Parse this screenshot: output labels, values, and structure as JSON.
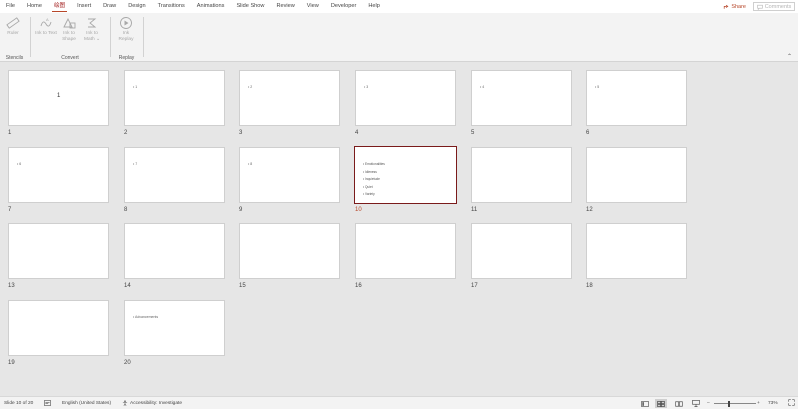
{
  "menu": {
    "tabs": [
      "File",
      "Home",
      "绘图",
      "Insert",
      "Draw",
      "Design",
      "Transitions",
      "Animations",
      "Slide Show",
      "Review",
      "View",
      "Developer",
      "Help"
    ],
    "active_index": 2,
    "share_label": "Share",
    "comments_label": "Comments"
  },
  "ribbon": {
    "groups": [
      {
        "label": "Stencils",
        "buttons": [
          "Ruler"
        ]
      },
      {
        "label": "Convert",
        "buttons": [
          "Ink to Text",
          "Ink to Shape",
          "Ink to Math"
        ]
      },
      {
        "label": "Replay",
        "buttons": [
          "Ink Replay"
        ]
      }
    ]
  },
  "slides": [
    {
      "number": "1",
      "content": "1"
    },
    {
      "number": "2",
      "content": "• 1"
    },
    {
      "number": "3",
      "content": "• 2"
    },
    {
      "number": "4",
      "content": "• 3"
    },
    {
      "number": "5",
      "content": "• 4"
    },
    {
      "number": "6",
      "content": "• 5"
    },
    {
      "number": "7",
      "content": "• 6"
    },
    {
      "number": "8",
      "content": "• 7"
    },
    {
      "number": "9",
      "content": "• 8"
    },
    {
      "number": "10",
      "bullets": [
        "• Emotionalities",
        "• Idleness",
        "• Inquietude",
        "• Quiet",
        "• Variety"
      ]
    },
    {
      "number": "11"
    },
    {
      "number": "12"
    },
    {
      "number": "13"
    },
    {
      "number": "14"
    },
    {
      "number": "15"
    },
    {
      "number": "16"
    },
    {
      "number": "17"
    },
    {
      "number": "18"
    },
    {
      "number": "19"
    },
    {
      "number": "20",
      "content": "• Advancements"
    }
  ],
  "selected_slide": "10",
  "status": {
    "slide_counter": "Slide 10 of 20",
    "language": "English (United States)",
    "accessibility": "Accessibility: Investigate",
    "zoom": "73%"
  },
  "colors": {
    "accent": "#b7472a",
    "selected_border": "#7a1b1b",
    "sorter_bg": "#e6e6e6"
  }
}
